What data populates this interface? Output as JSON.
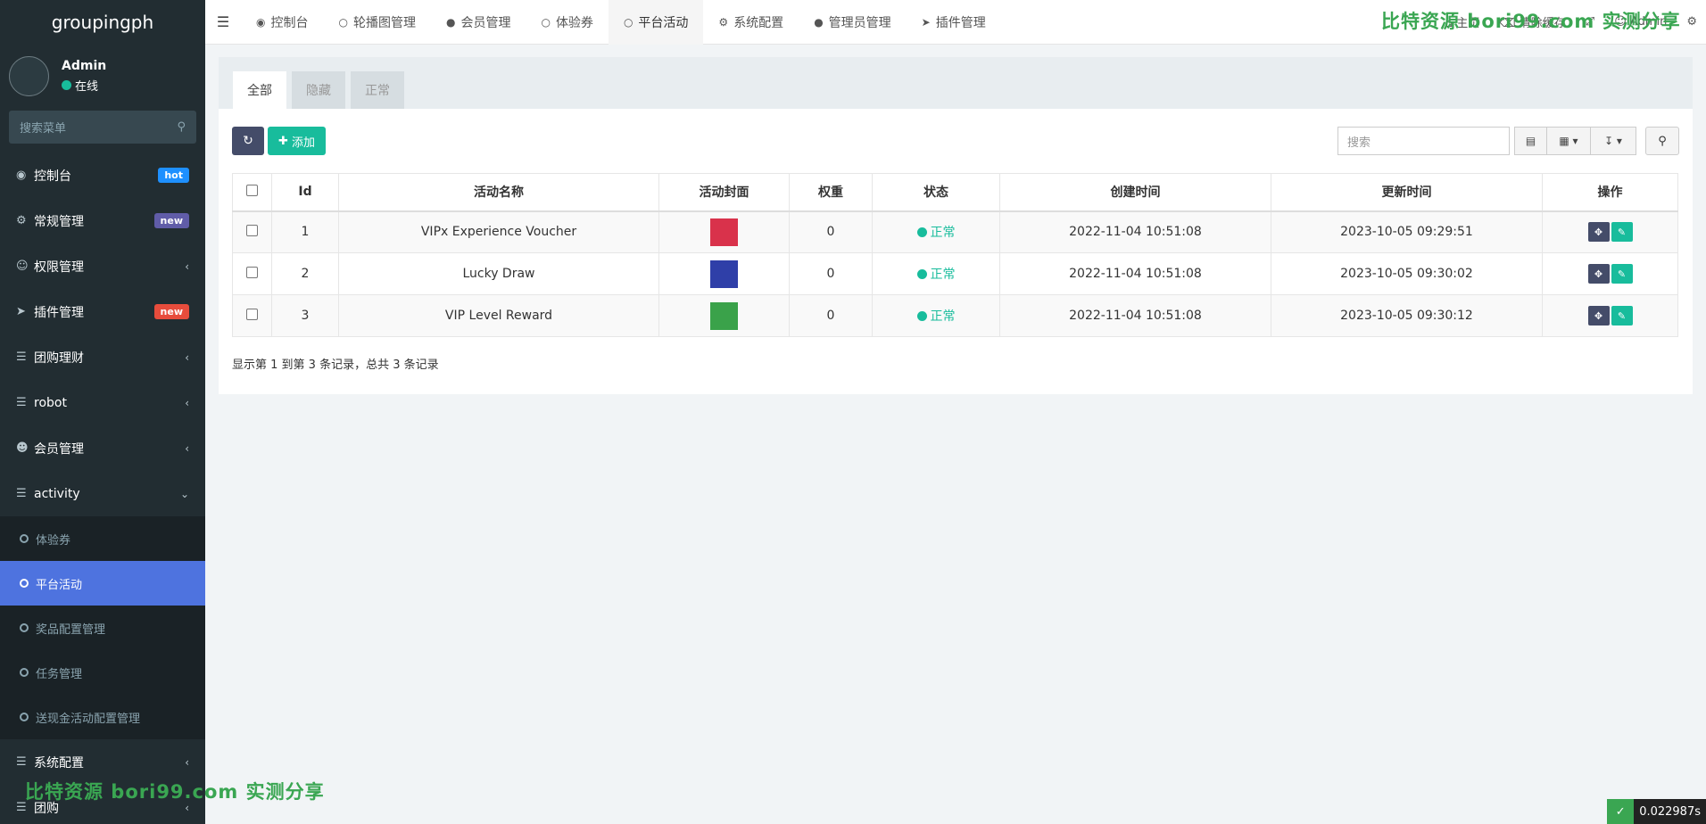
{
  "sidebar": {
    "logo": "groupingph",
    "user_name": "Admin",
    "user_status": "在线",
    "search_placeholder": "搜索菜单",
    "menu": [
      {
        "label": "控制台",
        "icon": "dashboard-icon",
        "badge": "hot"
      },
      {
        "label": "常规管理",
        "icon": "cogs-icon",
        "badge": "new"
      },
      {
        "label": "权限管理",
        "icon": "group-icon",
        "chevron": "‹"
      },
      {
        "label": "插件管理",
        "icon": "rocket-icon",
        "badge": "new"
      },
      {
        "label": "团购理财",
        "icon": "list-icon",
        "chevron": "‹"
      },
      {
        "label": "robot",
        "icon": "list-icon",
        "chevron": "‹"
      },
      {
        "label": "会员管理",
        "icon": "user-circle-icon",
        "chevron": "‹"
      },
      {
        "label": "activity",
        "icon": "list-icon",
        "chevron": "⌄"
      }
    ],
    "submenu": [
      {
        "label": "体验券"
      },
      {
        "label": "平台活动",
        "active": true
      },
      {
        "label": "奖品配置管理"
      },
      {
        "label": "任务管理"
      },
      {
        "label": "送现金活动配置管理"
      }
    ],
    "menu_after": [
      {
        "label": "系统配置",
        "icon": "list-icon",
        "chevron": "‹"
      },
      {
        "label": "团购",
        "icon": "list-icon",
        "chevron": "‹"
      }
    ]
  },
  "topnav": {
    "tabs": [
      {
        "label": "控制台",
        "icon": "dashboard-icon"
      },
      {
        "label": "轮播图管理",
        "icon": "circle-icon"
      },
      {
        "label": "会员管理",
        "icon": "user-icon"
      },
      {
        "label": "体验券",
        "icon": "circle-icon"
      },
      {
        "label": "平台活动",
        "icon": "circle-icon",
        "active": true
      },
      {
        "label": "系统配置",
        "icon": "cog-icon"
      },
      {
        "label": "管理员管理",
        "icon": "user-icon"
      },
      {
        "label": "插件管理",
        "icon": "rocket-icon"
      }
    ],
    "right": {
      "home": "主页",
      "clear_cache": "清除缓存",
      "admin": "Admin"
    }
  },
  "content": {
    "filter_tabs": [
      "全部",
      "隐藏",
      "正常"
    ],
    "add_label": "添加",
    "search_placeholder": "搜索",
    "columns": [
      "Id",
      "活动名称",
      "活动封面",
      "权重",
      "状态",
      "创建时间",
      "更新时间",
      "操作"
    ],
    "rows": [
      {
        "id": "1",
        "name": "VIPx Experience Voucher",
        "cover_color": "#d9324b",
        "weight": "0",
        "status": "正常",
        "created": "2022-11-04 10:51:08",
        "updated": "2023-10-05 09:29:51"
      },
      {
        "id": "2",
        "name": "Lucky Draw",
        "cover_color": "#2f3fa8",
        "weight": "0",
        "status": "正常",
        "created": "2022-11-04 10:51:08",
        "updated": "2023-10-05 09:30:02"
      },
      {
        "id": "3",
        "name": "VIP Level Reward",
        "cover_color": "#3aa24a",
        "weight": "0",
        "status": "正常",
        "created": "2022-11-04 10:51:08",
        "updated": "2023-10-05 09:30:12"
      }
    ],
    "summary": "显示第 1 到第 3 条记录，总共 3 条记录"
  },
  "watermark": "比特资源 bori99.com 实测分享",
  "timer": "0.022987s",
  "colors": {
    "accent": "#18bc9c",
    "primary": "#444c69",
    "sidebar_active": "#4e73df"
  }
}
